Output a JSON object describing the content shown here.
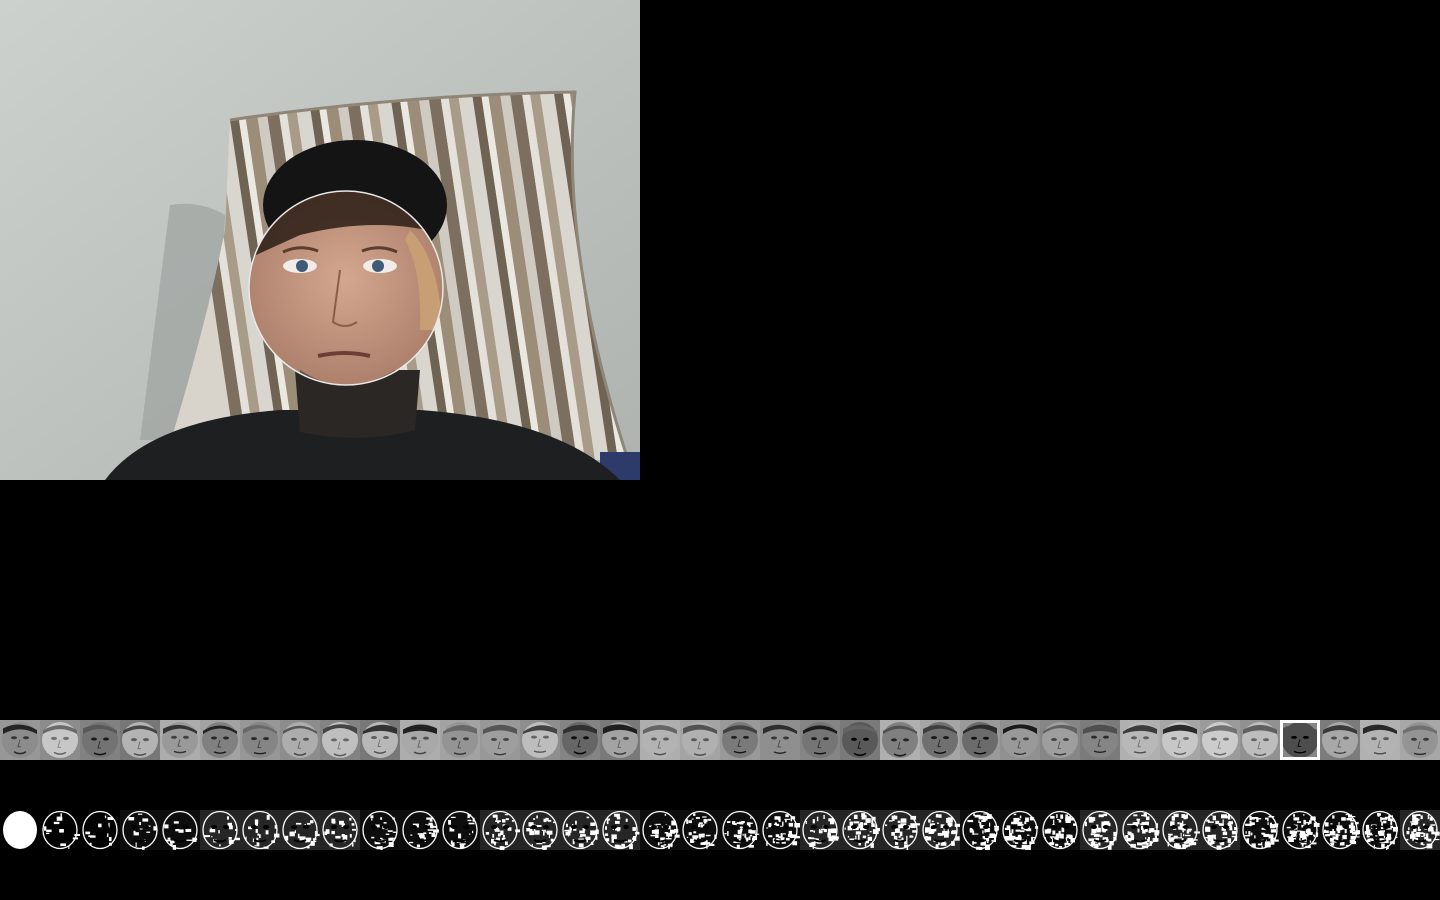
{
  "camera": {
    "label": "camera-feed",
    "colors": {
      "wall": "#c6cbc8",
      "pillow_light": "#d9d6cf",
      "pillow_stripe_dark": "#7d6f5f",
      "pillow_stripe_mid": "#a89b88",
      "sweater": "#1d1f21",
      "hair": "#141414",
      "skin": "#c79a82",
      "blue_corner": "#2c3b6a"
    }
  },
  "face_strip": {
    "count": 36,
    "selected_index": 32,
    "background": "#8e8e8e",
    "tones": [
      0.55,
      0.78,
      0.45,
      0.7,
      0.6,
      0.5,
      0.52,
      0.68,
      0.75,
      0.72,
      0.66,
      0.58,
      0.62,
      0.74,
      0.4,
      0.64,
      0.7,
      0.69,
      0.48,
      0.56,
      0.46,
      0.35,
      0.5,
      0.44,
      0.42,
      0.6,
      0.62,
      0.52,
      0.72,
      0.78,
      0.8,
      0.74,
      0.3,
      0.66,
      0.7,
      0.58
    ]
  },
  "eigen_strip": {
    "count": 36,
    "background": "#000000",
    "seeds": [
      1,
      2,
      3,
      4,
      5,
      6,
      7,
      8,
      9,
      10,
      11,
      12,
      13,
      14,
      15,
      16,
      17,
      18,
      19,
      20,
      21,
      22,
      23,
      24,
      25,
      26,
      27,
      28,
      29,
      30,
      31,
      32,
      33,
      34,
      35,
      36
    ]
  }
}
